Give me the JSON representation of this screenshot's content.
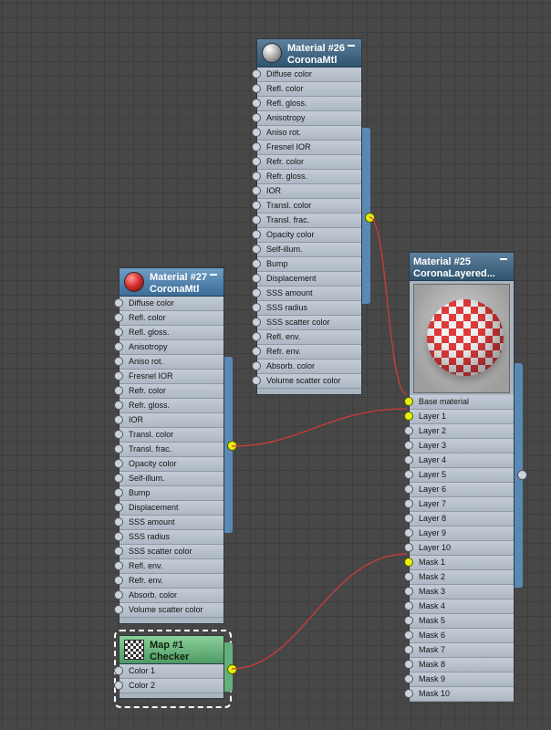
{
  "nodes": {
    "mat26": {
      "name": "Material #26",
      "type": "CoronaMtl",
      "slots": [
        "Diffuse color",
        "Refl. color",
        "Refl. gloss.",
        "Anisotropy",
        "Aniso rot.",
        "Fresnel IOR",
        "Refr. color",
        "Refr. gloss.",
        "IOR",
        "Transl. color",
        "Transl. frac.",
        "Opacity color",
        "Self-illum.",
        "Bump",
        "Displacement",
        "SSS amount",
        "SSS radius",
        "SSS scatter color",
        "Refl. env.",
        "Refr. env.",
        "Absorb. color",
        "Volume scatter color"
      ]
    },
    "mat27": {
      "name": "Material #27",
      "type": "CoronaMtl",
      "slots": [
        "Diffuse color",
        "Refl. color",
        "Refl. gloss.",
        "Anisotropy",
        "Aniso rot.",
        "Fresnel IOR",
        "Refr. color",
        "Refr. gloss.",
        "IOR",
        "Transl. color",
        "Transl. frac.",
        "Opacity color",
        "Self-illum.",
        "Bump",
        "Displacement",
        "SSS amount",
        "SSS radius",
        "SSS scatter color",
        "Refl. env.",
        "Refr. env.",
        "Absorb. color",
        "Volume scatter color"
      ]
    },
    "mat25": {
      "name": "Material #25",
      "type": "CoronaLayered...",
      "slots": [
        "Base material",
        "Layer 1",
        "Layer 2",
        "Layer 3",
        "Layer 4",
        "Layer 5",
        "Layer 6",
        "Layer 7",
        "Layer 8",
        "Layer 9",
        "Layer 10",
        "Mask 1",
        "Mask 2",
        "Mask 3",
        "Mask 4",
        "Mask 5",
        "Mask 6",
        "Mask 7",
        "Mask 8",
        "Mask 9",
        "Mask 10"
      ],
      "connected_slots": [
        "Base material",
        "Layer 1",
        "Mask 1"
      ]
    },
    "map1": {
      "name": "Map #1",
      "type": "Checker",
      "slots": [
        "Color 1",
        "Color 2"
      ]
    }
  },
  "colors": {
    "wire": "#d23a3a",
    "socket_active": "#e5f00e",
    "node_header": "#3c6d98",
    "map_header": "#4f9a63"
  }
}
